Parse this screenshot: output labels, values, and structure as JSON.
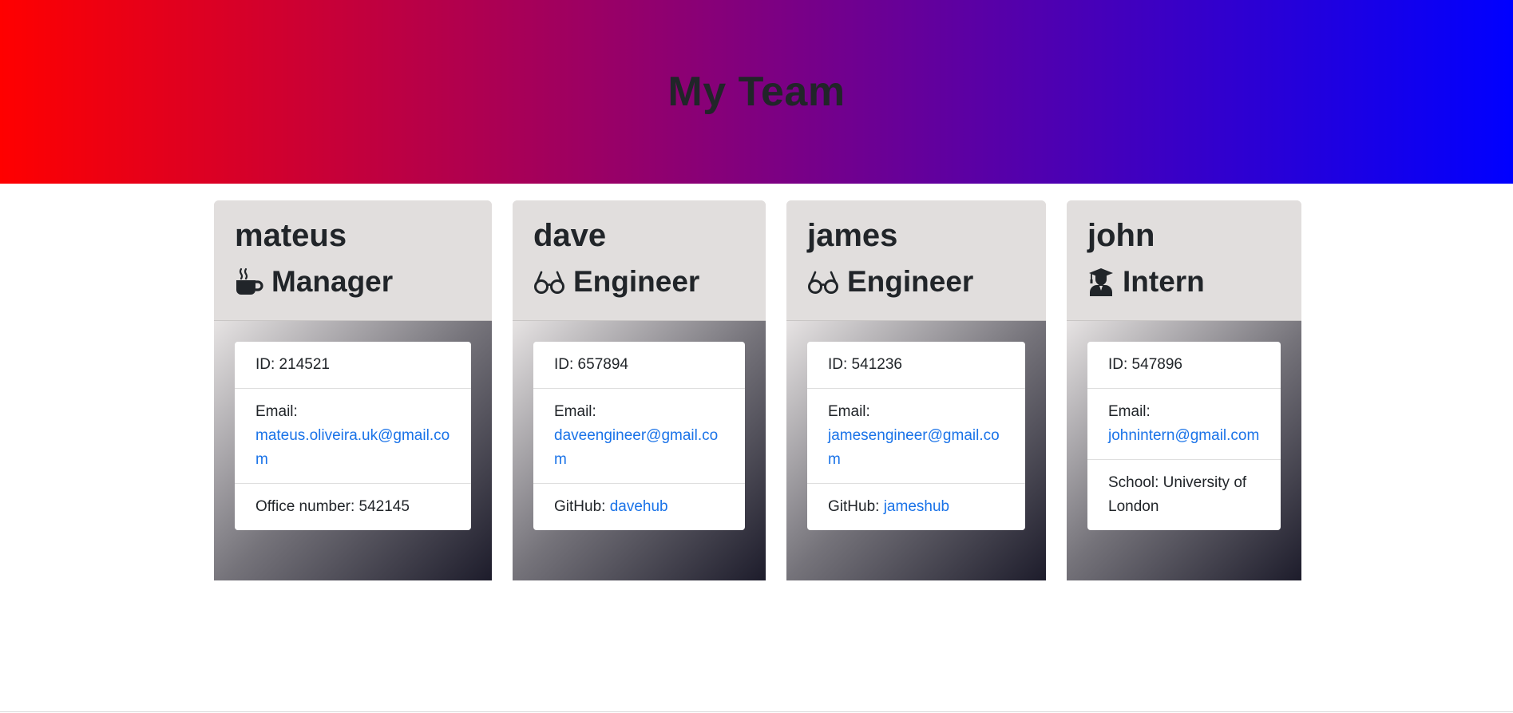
{
  "header": {
    "title": "My Team"
  },
  "team": [
    {
      "name": "mateus",
      "role": "Manager",
      "role_icon": "coffee-mug-icon",
      "id_text": "ID: 214521",
      "email_label": "Email:",
      "email": "mateus.oliveira.uk@gmail.com",
      "extra_label": "Office number: 542145",
      "extra_link": ""
    },
    {
      "name": "dave",
      "role": "Engineer",
      "role_icon": "glasses-icon",
      "id_text": "ID: 657894",
      "email_label": "Email:",
      "email": "daveengineer@gmail.com",
      "extra_label": "GitHub: ",
      "extra_link": "davehub"
    },
    {
      "name": "james",
      "role": "Engineer",
      "role_icon": "glasses-icon",
      "id_text": "ID: 541236",
      "email_label": "Email:",
      "email": "jamesengineer@gmail.com",
      "extra_label": "GitHub: ",
      "extra_link": "jameshub"
    },
    {
      "name": "john",
      "role": "Intern",
      "role_icon": "graduate-icon",
      "id_text": "ID: 547896",
      "email_label": "Email:",
      "email": "johnintern@gmail.com",
      "extra_label": "School: University of London",
      "extra_link": ""
    }
  ],
  "colors": {
    "header_gradient_start": "#ff0000",
    "header_gradient_end": "#0000ff",
    "card_head_bg": "#e1dedd",
    "link": "#1a73e8"
  }
}
